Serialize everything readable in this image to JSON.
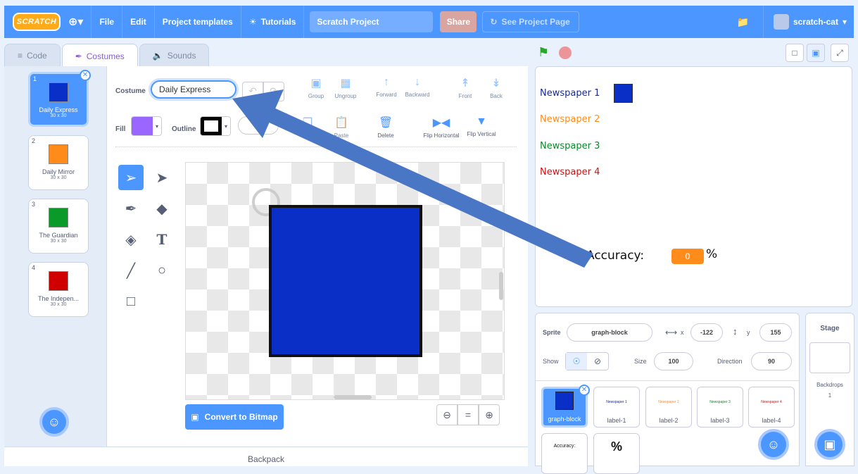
{
  "menu": {
    "logo": "SCRATCH",
    "globe": "⊕▾",
    "file": "File",
    "edit": "Edit",
    "templates": "Project templates",
    "tutorials": "Tutorials",
    "title": "Scratch Project",
    "share": "Share",
    "see_page": "See Project Page",
    "username": "scratch-cat"
  },
  "tabs": [
    {
      "label": "Code",
      "icon": "code-icon"
    },
    {
      "label": "Costumes",
      "icon": "brush-icon"
    },
    {
      "label": "Sounds",
      "icon": "speaker-icon"
    }
  ],
  "costumes": [
    {
      "num": "1",
      "name": "Daily Express",
      "size": "30 x 30",
      "color": "#0a2fc7"
    },
    {
      "num": "2",
      "name": "Daily Mirror",
      "size": "30 x 30",
      "color": "#ff8c1a"
    },
    {
      "num": "3",
      "name": "The Guardian",
      "size": "30 x 30",
      "color": "#0a9a2a"
    },
    {
      "num": "4",
      "name": "The Indepen...",
      "size": "30 x 30",
      "color": "#d00000"
    }
  ],
  "editor": {
    "costume_label": "Costume",
    "costume_name": "Daily Express",
    "fill_label": "Fill",
    "outline_label": "Outline",
    "outline_width": "4",
    "tools": {
      "group": "Group",
      "ungroup": "Ungroup",
      "forward": "Forward",
      "backward": "Backward",
      "front": "Front",
      "back": "Back",
      "copy": "Copy",
      "paste": "Paste",
      "delete": "Delete",
      "flip_h": "Flip Horizontal",
      "flip_v": "Flip Vertical"
    },
    "convert": "Convert to Bitmap",
    "fill_color": "#9966ff",
    "outline_color": "#000000",
    "shape_color": "#0a2fc7"
  },
  "backpack": "Backpack",
  "stage": {
    "labels": [
      {
        "text": "Newspaper 1",
        "color": "#1a2a9a"
      },
      {
        "text": "Newspaper 2",
        "color": "#ff8c1a"
      },
      {
        "text": "Newspaper 3",
        "color": "#0a8a2a"
      },
      {
        "text": "Newspaper 4",
        "color": "#d01010"
      }
    ],
    "accuracy_label": "Accuracy:",
    "accuracy_value": "0",
    "percent": "%"
  },
  "sprite_info": {
    "sprite_label": "Sprite",
    "sprite_name": "graph-block",
    "x_label": "x",
    "x_value": "-122",
    "y_label": "y",
    "y_value": "155",
    "show_label": "Show",
    "size_label": "Size",
    "size_value": "100",
    "direction_label": "Direction",
    "direction_value": "90"
  },
  "sprites": [
    {
      "name": "graph-block",
      "preview": ""
    },
    {
      "name": "label-1",
      "preview": "Newspaper 1"
    },
    {
      "name": "label-2",
      "preview": "Newspaper 2"
    },
    {
      "name": "label-3",
      "preview": "Newspaper 3"
    },
    {
      "name": "label-4",
      "preview": "Newspaper 4"
    },
    {
      "name": "",
      "preview": "Accuracy:"
    },
    {
      "name": "",
      "preview": "%"
    }
  ],
  "stage_pane": {
    "title": "Stage",
    "backdrops_label": "Backdrops",
    "backdrops_count": "1"
  }
}
